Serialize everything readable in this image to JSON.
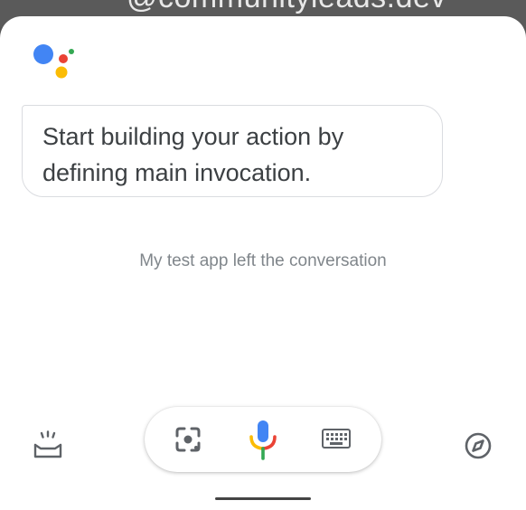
{
  "background_text": "@communityleads.dev",
  "assistant": {
    "message": "Start building your action by defining main invocation.",
    "status": "My test app left the conversation"
  },
  "toolbar": {
    "left_icon": "updates-snapshot-icon",
    "lens_icon": "google-lens-icon",
    "mic_icon": "microphone-icon",
    "keyboard_icon": "keyboard-icon",
    "right_icon": "compass-explore-icon"
  },
  "colors": {
    "blue": "#4285F4",
    "red": "#EA4335",
    "yellow": "#FBBC05",
    "green": "#34A853",
    "icon_gray": "#5f6368",
    "bubble_border": "#dadce0",
    "status_text": "#80868b"
  }
}
